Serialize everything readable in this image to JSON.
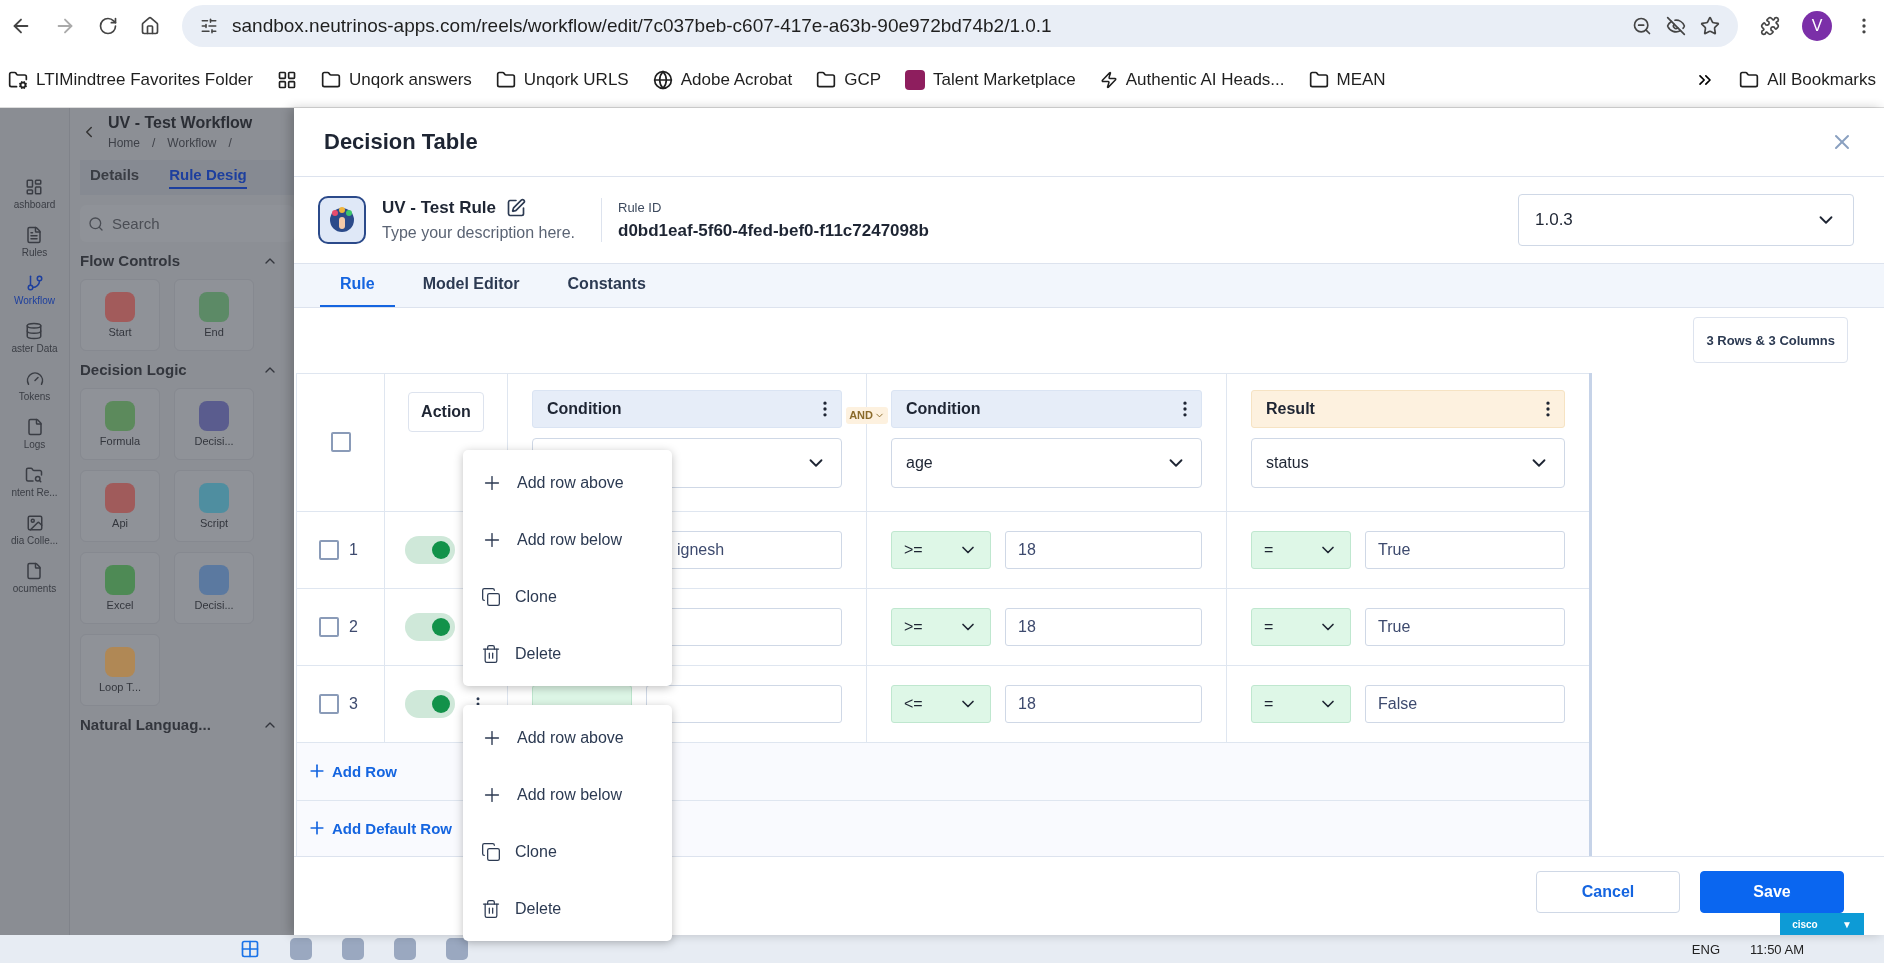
{
  "browser": {
    "url": "sandbox.neutrinos-apps.com/reels/workflow/edit/7c037beb-c607-417e-a63b-90e972bd74b2/1.0.1",
    "profile": "V",
    "bookmarks": [
      {
        "label": "LTIMindtree Favorites Folder",
        "kind": "managed"
      },
      {
        "kind": "apps"
      },
      {
        "label": "Unqork answers",
        "kind": "folder"
      },
      {
        "label": "Unqork URLS",
        "kind": "folder"
      },
      {
        "label": "Adobe Acrobat",
        "kind": "globe"
      },
      {
        "label": "GCP",
        "kind": "folder"
      },
      {
        "label": "Talent Marketplace",
        "kind": "app"
      },
      {
        "label": "Authentic AI Heads...",
        "kind": "bolt"
      },
      {
        "label": "MEAN",
        "kind": "folder"
      }
    ],
    "all_bookmarks": "All Bookmarks"
  },
  "background": {
    "title": "UV - Test Workflow",
    "breadcrumbs": [
      "Home",
      "/",
      "Workflow",
      "/"
    ],
    "nav": [
      "ashboard",
      "Rules",
      "Workflow",
      "aster Data",
      "Tokens",
      "Logs",
      "ntent Re...",
      "dia Colle...",
      "ocuments"
    ],
    "tabs": [
      {
        "label": "Details",
        "selected": false
      },
      {
        "label": "Rule Desig",
        "selected": true
      }
    ],
    "search": {
      "placeholder": "Search"
    },
    "sections": [
      {
        "title": "Flow Controls",
        "items": [
          "Start",
          "End"
        ]
      },
      {
        "title": "Decision Logic",
        "items": [
          "Formula",
          "Decisi...",
          "Api",
          "Script",
          "Excel",
          "Decisi...",
          "Loop T..."
        ]
      },
      {
        "title": "Natural Languag..."
      }
    ]
  },
  "dialog": {
    "title": "Decision Table",
    "rule": {
      "name": "UV - Test Rule",
      "description": "Type your description here.",
      "id_label": "Rule ID",
      "id": "d0bd1eaf-5f60-4fed-bef0-f11c7247098b",
      "version": "1.0.3"
    },
    "tabs": [
      {
        "label": "Rule",
        "selected": true
      },
      {
        "label": "Model Editor",
        "selected": false
      },
      {
        "label": "Constants",
        "selected": false
      }
    ],
    "size_button": "3 Rows & 3 Columns",
    "table": {
      "action_label": "Action",
      "all_checked": false,
      "columns": [
        {
          "kind": "condition",
          "title": "Condition",
          "joiner": "AND"
        },
        {
          "kind": "condition",
          "title": "Condition",
          "field": "age"
        },
        {
          "kind": "result",
          "title": "Result",
          "field": "status"
        }
      ],
      "rows": [
        {
          "number": "1",
          "checked": false,
          "enabled": true,
          "cells": [
            {
              "value": "ignesh"
            },
            {
              "operator": ">=",
              "value": "18"
            },
            {
              "operator": "=",
              "value": "True"
            }
          ]
        },
        {
          "number": "2",
          "checked": false,
          "enabled": true,
          "cells": [
            {},
            {
              "operator": ">=",
              "value": "18"
            },
            {
              "operator": "=",
              "value": "True"
            }
          ]
        },
        {
          "number": "3",
          "checked": false,
          "enabled": true,
          "cells": [
            {},
            {
              "operator": "<=",
              "value": "18"
            },
            {
              "operator": "=",
              "value": "False"
            }
          ]
        }
      ],
      "add_row": "Add Row",
      "add_default_row": "Add Default Row"
    },
    "menus": [
      [
        {
          "kind": "add",
          "label": "Add row above"
        },
        {
          "kind": "add",
          "label": "Add row below"
        },
        {
          "kind": "clone",
          "label": "Clone"
        },
        {
          "kind": "delete",
          "label": "Delete"
        }
      ],
      [
        {
          "kind": "add",
          "label": "Add row above"
        },
        {
          "kind": "add",
          "label": "Add row below"
        },
        {
          "kind": "clone",
          "label": "Clone"
        },
        {
          "kind": "delete",
          "label": "Delete"
        }
      ]
    ],
    "buttons": [
      {
        "kind": "secondary",
        "label": "Cancel"
      },
      {
        "kind": "primary",
        "label": "Save"
      }
    ]
  },
  "widget": {
    "brand": "cisco",
    "caret": "▼"
  },
  "taskbar": {
    "language": "ENG",
    "time": "11:50 AM"
  }
}
